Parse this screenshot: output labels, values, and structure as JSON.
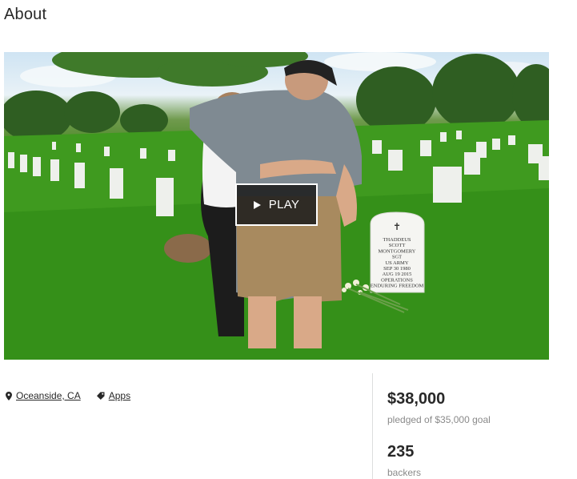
{
  "page": {
    "title": "About"
  },
  "video": {
    "play_label": "PLAY",
    "headstone_text": [
      "THADDEUS",
      "SCOTT",
      "MONTGOMERY",
      "SGT",
      "US ARMY",
      "SEP 30 1980",
      "AUG 19 2015",
      "OPERATIONS",
      "ENDURING FREEDOM"
    ]
  },
  "meta": {
    "location": {
      "label": "Oceanside, CA",
      "icon": "location-pin-icon"
    },
    "category": {
      "label": "Apps",
      "icon": "tag-icon"
    }
  },
  "stats": {
    "pledged_amount": "$38,000",
    "pledged_caption": "pledged of $35,000 goal",
    "backers_count": "235",
    "backers_caption": "backers"
  }
}
